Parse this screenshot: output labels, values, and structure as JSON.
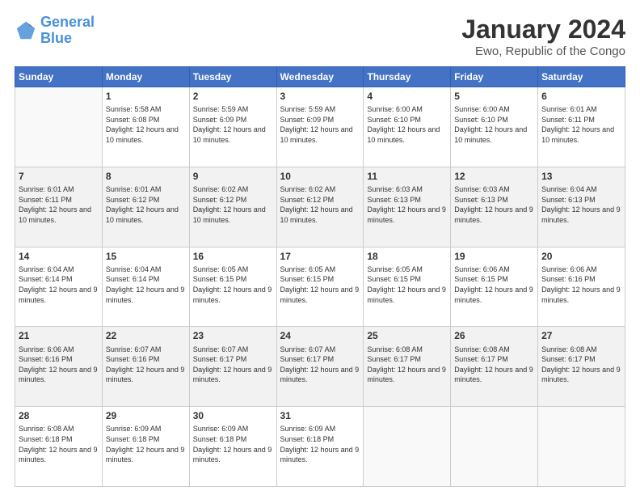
{
  "logo": {
    "text_general": "General",
    "text_blue": "Blue"
  },
  "header": {
    "title": "January 2024",
    "subtitle": "Ewo, Republic of the Congo"
  },
  "weekdays": [
    "Sunday",
    "Monday",
    "Tuesday",
    "Wednesday",
    "Thursday",
    "Friday",
    "Saturday"
  ],
  "weeks": [
    [
      {
        "day": null,
        "sunrise": null,
        "sunset": null,
        "daylight": null
      },
      {
        "day": "1",
        "sunrise": "Sunrise: 5:58 AM",
        "sunset": "Sunset: 6:08 PM",
        "daylight": "Daylight: 12 hours and 10 minutes."
      },
      {
        "day": "2",
        "sunrise": "Sunrise: 5:59 AM",
        "sunset": "Sunset: 6:09 PM",
        "daylight": "Daylight: 12 hours and 10 minutes."
      },
      {
        "day": "3",
        "sunrise": "Sunrise: 5:59 AM",
        "sunset": "Sunset: 6:09 PM",
        "daylight": "Daylight: 12 hours and 10 minutes."
      },
      {
        "day": "4",
        "sunrise": "Sunrise: 6:00 AM",
        "sunset": "Sunset: 6:10 PM",
        "daylight": "Daylight: 12 hours and 10 minutes."
      },
      {
        "day": "5",
        "sunrise": "Sunrise: 6:00 AM",
        "sunset": "Sunset: 6:10 PM",
        "daylight": "Daylight: 12 hours and 10 minutes."
      },
      {
        "day": "6",
        "sunrise": "Sunrise: 6:01 AM",
        "sunset": "Sunset: 6:11 PM",
        "daylight": "Daylight: 12 hours and 10 minutes."
      }
    ],
    [
      {
        "day": "7",
        "sunrise": "Sunrise: 6:01 AM",
        "sunset": "Sunset: 6:11 PM",
        "daylight": "Daylight: 12 hours and 10 minutes."
      },
      {
        "day": "8",
        "sunrise": "Sunrise: 6:01 AM",
        "sunset": "Sunset: 6:12 PM",
        "daylight": "Daylight: 12 hours and 10 minutes."
      },
      {
        "day": "9",
        "sunrise": "Sunrise: 6:02 AM",
        "sunset": "Sunset: 6:12 PM",
        "daylight": "Daylight: 12 hours and 10 minutes."
      },
      {
        "day": "10",
        "sunrise": "Sunrise: 6:02 AM",
        "sunset": "Sunset: 6:12 PM",
        "daylight": "Daylight: 12 hours and 10 minutes."
      },
      {
        "day": "11",
        "sunrise": "Sunrise: 6:03 AM",
        "sunset": "Sunset: 6:13 PM",
        "daylight": "Daylight: 12 hours and 9 minutes."
      },
      {
        "day": "12",
        "sunrise": "Sunrise: 6:03 AM",
        "sunset": "Sunset: 6:13 PM",
        "daylight": "Daylight: 12 hours and 9 minutes."
      },
      {
        "day": "13",
        "sunrise": "Sunrise: 6:04 AM",
        "sunset": "Sunset: 6:13 PM",
        "daylight": "Daylight: 12 hours and 9 minutes."
      }
    ],
    [
      {
        "day": "14",
        "sunrise": "Sunrise: 6:04 AM",
        "sunset": "Sunset: 6:14 PM",
        "daylight": "Daylight: 12 hours and 9 minutes."
      },
      {
        "day": "15",
        "sunrise": "Sunrise: 6:04 AM",
        "sunset": "Sunset: 6:14 PM",
        "daylight": "Daylight: 12 hours and 9 minutes."
      },
      {
        "day": "16",
        "sunrise": "Sunrise: 6:05 AM",
        "sunset": "Sunset: 6:15 PM",
        "daylight": "Daylight: 12 hours and 9 minutes."
      },
      {
        "day": "17",
        "sunrise": "Sunrise: 6:05 AM",
        "sunset": "Sunset: 6:15 PM",
        "daylight": "Daylight: 12 hours and 9 minutes."
      },
      {
        "day": "18",
        "sunrise": "Sunrise: 6:05 AM",
        "sunset": "Sunset: 6:15 PM",
        "daylight": "Daylight: 12 hours and 9 minutes."
      },
      {
        "day": "19",
        "sunrise": "Sunrise: 6:06 AM",
        "sunset": "Sunset: 6:15 PM",
        "daylight": "Daylight: 12 hours and 9 minutes."
      },
      {
        "day": "20",
        "sunrise": "Sunrise: 6:06 AM",
        "sunset": "Sunset: 6:16 PM",
        "daylight": "Daylight: 12 hours and 9 minutes."
      }
    ],
    [
      {
        "day": "21",
        "sunrise": "Sunrise: 6:06 AM",
        "sunset": "Sunset: 6:16 PM",
        "daylight": "Daylight: 12 hours and 9 minutes."
      },
      {
        "day": "22",
        "sunrise": "Sunrise: 6:07 AM",
        "sunset": "Sunset: 6:16 PM",
        "daylight": "Daylight: 12 hours and 9 minutes."
      },
      {
        "day": "23",
        "sunrise": "Sunrise: 6:07 AM",
        "sunset": "Sunset: 6:17 PM",
        "daylight": "Daylight: 12 hours and 9 minutes."
      },
      {
        "day": "24",
        "sunrise": "Sunrise: 6:07 AM",
        "sunset": "Sunset: 6:17 PM",
        "daylight": "Daylight: 12 hours and 9 minutes."
      },
      {
        "day": "25",
        "sunrise": "Sunrise: 6:08 AM",
        "sunset": "Sunset: 6:17 PM",
        "daylight": "Daylight: 12 hours and 9 minutes."
      },
      {
        "day": "26",
        "sunrise": "Sunrise: 6:08 AM",
        "sunset": "Sunset: 6:17 PM",
        "daylight": "Daylight: 12 hours and 9 minutes."
      },
      {
        "day": "27",
        "sunrise": "Sunrise: 6:08 AM",
        "sunset": "Sunset: 6:17 PM",
        "daylight": "Daylight: 12 hours and 9 minutes."
      }
    ],
    [
      {
        "day": "28",
        "sunrise": "Sunrise: 6:08 AM",
        "sunset": "Sunset: 6:18 PM",
        "daylight": "Daylight: 12 hours and 9 minutes."
      },
      {
        "day": "29",
        "sunrise": "Sunrise: 6:09 AM",
        "sunset": "Sunset: 6:18 PM",
        "daylight": "Daylight: 12 hours and 9 minutes."
      },
      {
        "day": "30",
        "sunrise": "Sunrise: 6:09 AM",
        "sunset": "Sunset: 6:18 PM",
        "daylight": "Daylight: 12 hours and 9 minutes."
      },
      {
        "day": "31",
        "sunrise": "Sunrise: 6:09 AM",
        "sunset": "Sunset: 6:18 PM",
        "daylight": "Daylight: 12 hours and 9 minutes."
      },
      {
        "day": null,
        "sunrise": null,
        "sunset": null,
        "daylight": null
      },
      {
        "day": null,
        "sunrise": null,
        "sunset": null,
        "daylight": null
      },
      {
        "day": null,
        "sunrise": null,
        "sunset": null,
        "daylight": null
      }
    ]
  ]
}
